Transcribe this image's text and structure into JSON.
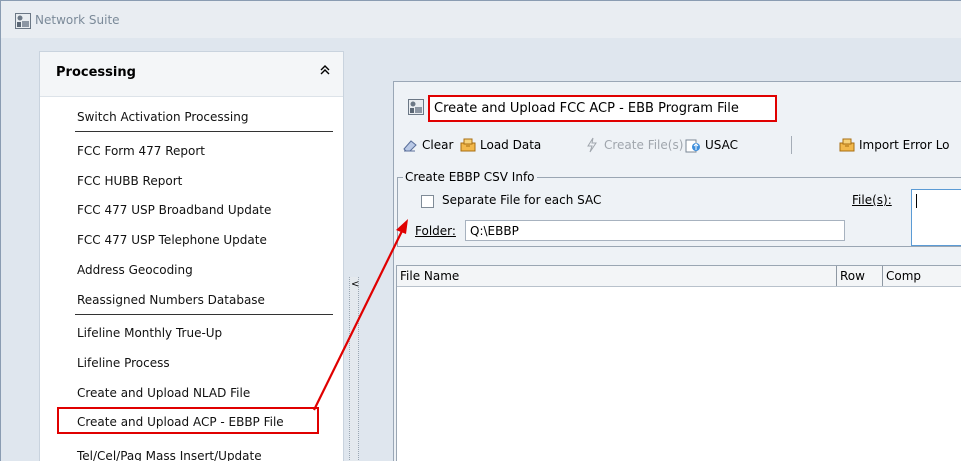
{
  "app": {
    "title": "Network Suite"
  },
  "processing": {
    "title": "Processing",
    "collapse_glyph": "≈",
    "items": [
      "Switch Activation Processing",
      "FCC Form 477 Report",
      "FCC HUBB Report",
      "FCC 477 USP Broadband Update",
      "FCC 477 USP Telephone Update",
      "Address Geocoding",
      "Reassigned Numbers Database",
      "Lifeline Monthly True-Up",
      "Lifeline Process",
      "Create and Upload NLAD File",
      "Create and Upload ACP - EBBP File",
      "Tel/Cel/Pag Mass Insert/Update"
    ]
  },
  "splitter": {
    "arrow": "<"
  },
  "dialog": {
    "title": "Create and Upload FCC ACP - EBB Program File",
    "toolbar": {
      "clear": "Clear",
      "load_data": "Load Data",
      "create_files": "Create File(s)",
      "usac": "USAC",
      "import_error_log": "Import Error Lo"
    },
    "csv_group": {
      "legend": "Create EBBP CSV Info",
      "separate_file_label": "Separate File for each SAC",
      "separate_file_checked": false,
      "files_label": "File(s):",
      "folder_label": "Folder:",
      "folder_value": "Q:\\EBBP"
    },
    "grid": {
      "columns": [
        "File Name",
        "Row",
        "Comp"
      ]
    }
  },
  "colors": {
    "highlight": "#e00000",
    "accent": "#5b9bd5"
  }
}
